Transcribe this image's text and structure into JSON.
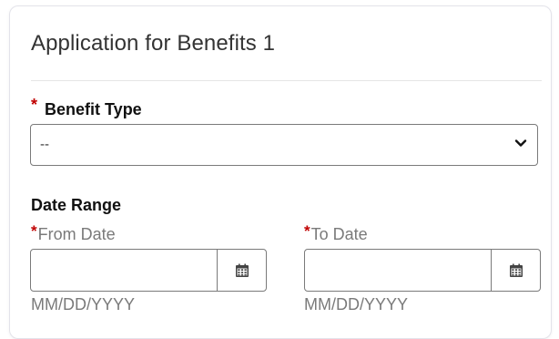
{
  "card": {
    "title": "Application for Benefits 1"
  },
  "benefit_type": {
    "required_mark": "*",
    "label": "Benefit Type",
    "selected_value": "--"
  },
  "date_range": {
    "label": "Date Range",
    "from": {
      "required_mark": "*",
      "label": "From Date",
      "value": "",
      "hint": "MM/DD/YYYY"
    },
    "to": {
      "required_mark": "*",
      "label": "To Date",
      "value": "",
      "hint": "MM/DD/YYYY"
    }
  },
  "icons": {
    "select_arrow": "chevron-down-icon",
    "calendar": "calendar-icon"
  },
  "colors": {
    "required": "#c00000",
    "border": "#7a7a7a",
    "muted_text": "#7a7a7a"
  }
}
